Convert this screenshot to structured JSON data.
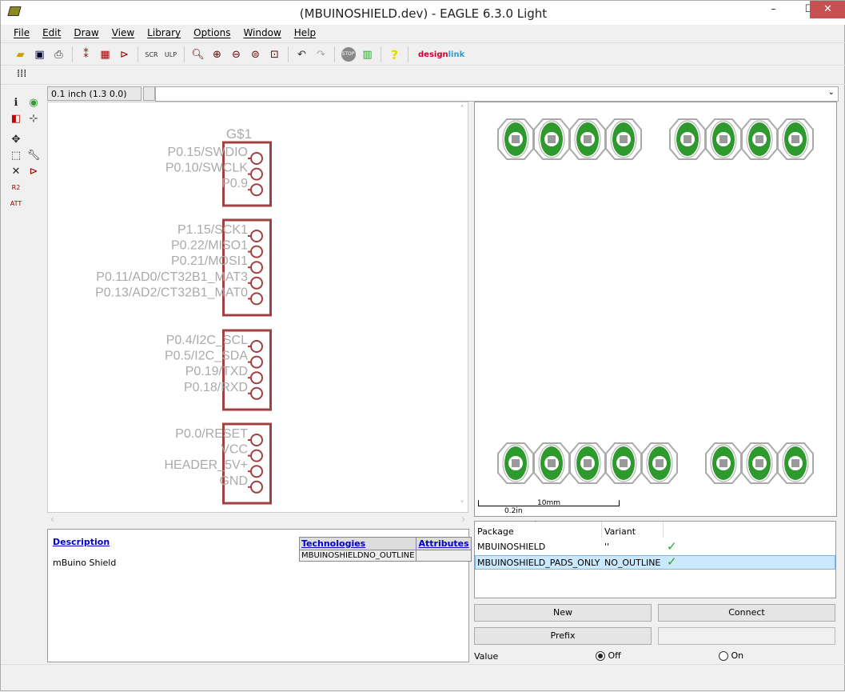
{
  "window": {
    "title": "(MBUINOSHIELD.dev) - EAGLE 6.3.0 Light"
  },
  "menu": [
    "File",
    "Edit",
    "Draw",
    "View",
    "Library",
    "Options",
    "Window",
    "Help"
  ],
  "toolbar": {
    "icons": [
      "open-icon",
      "save-icon",
      "print-icon",
      "board-icon",
      "package-icon",
      "symbol-icon",
      "script-icon",
      "ulp-icon",
      "zoom-fit-icon",
      "zoom-in-icon",
      "zoom-out-icon",
      "zoom-redraw-icon",
      "zoom-select-icon",
      "undo-icon",
      "redo-icon",
      "stop-icon",
      "go-icon",
      "help-icon"
    ],
    "designlink": "designlink"
  },
  "coord": "0.1 inch (1.3 0.0)",
  "schematic": {
    "part_name": "G$1",
    "groups": [
      [
        "P0.15/SWDIO",
        "P0.10/SWCLK",
        "P0.9"
      ],
      [
        "P1.15/SCK1",
        "P0.22/MISO1",
        "P0.21/MOSI1",
        "P0.11/AD0/CT32B1_MAT3",
        "P0.13/AD2/CT32B1_MAT0"
      ],
      [
        "P0.4/I2C_SCL",
        "P0.5/I2C_SDA",
        "P0.19/TXD",
        "P0.18/RXD"
      ],
      [
        "P0.0/RESET",
        "VCC",
        "HEADER_5V+",
        "GND"
      ]
    ],
    "symbol_color": "#a04040",
    "label_color": "#aaaaaa"
  },
  "description": {
    "heading": "Description",
    "text": "mBuino Shield",
    "technologies_header": "Technologies",
    "attributes_header": "Attributes",
    "technology": "MBUINOSHIELDNO_OUTLINE"
  },
  "preview": {
    "scale_mm": "10mm",
    "scale_in": "0.2in",
    "pad_color": "#2e9a2e"
  },
  "packages": {
    "headers": [
      "Package",
      "Variant"
    ],
    "rows": [
      {
        "package": "MBUINOSHIELD",
        "variant": "''",
        "ok": true,
        "selected": false
      },
      {
        "package": "MBUINOSHIELD_PADS_ONLY",
        "variant": "NO_OUTLINE",
        "ok": true,
        "selected": true
      }
    ]
  },
  "buttons": {
    "new": "New",
    "connect": "Connect",
    "prefix": "Prefix"
  },
  "value": {
    "label": "Value",
    "off": "Off",
    "on": "On",
    "selected": "Off"
  }
}
